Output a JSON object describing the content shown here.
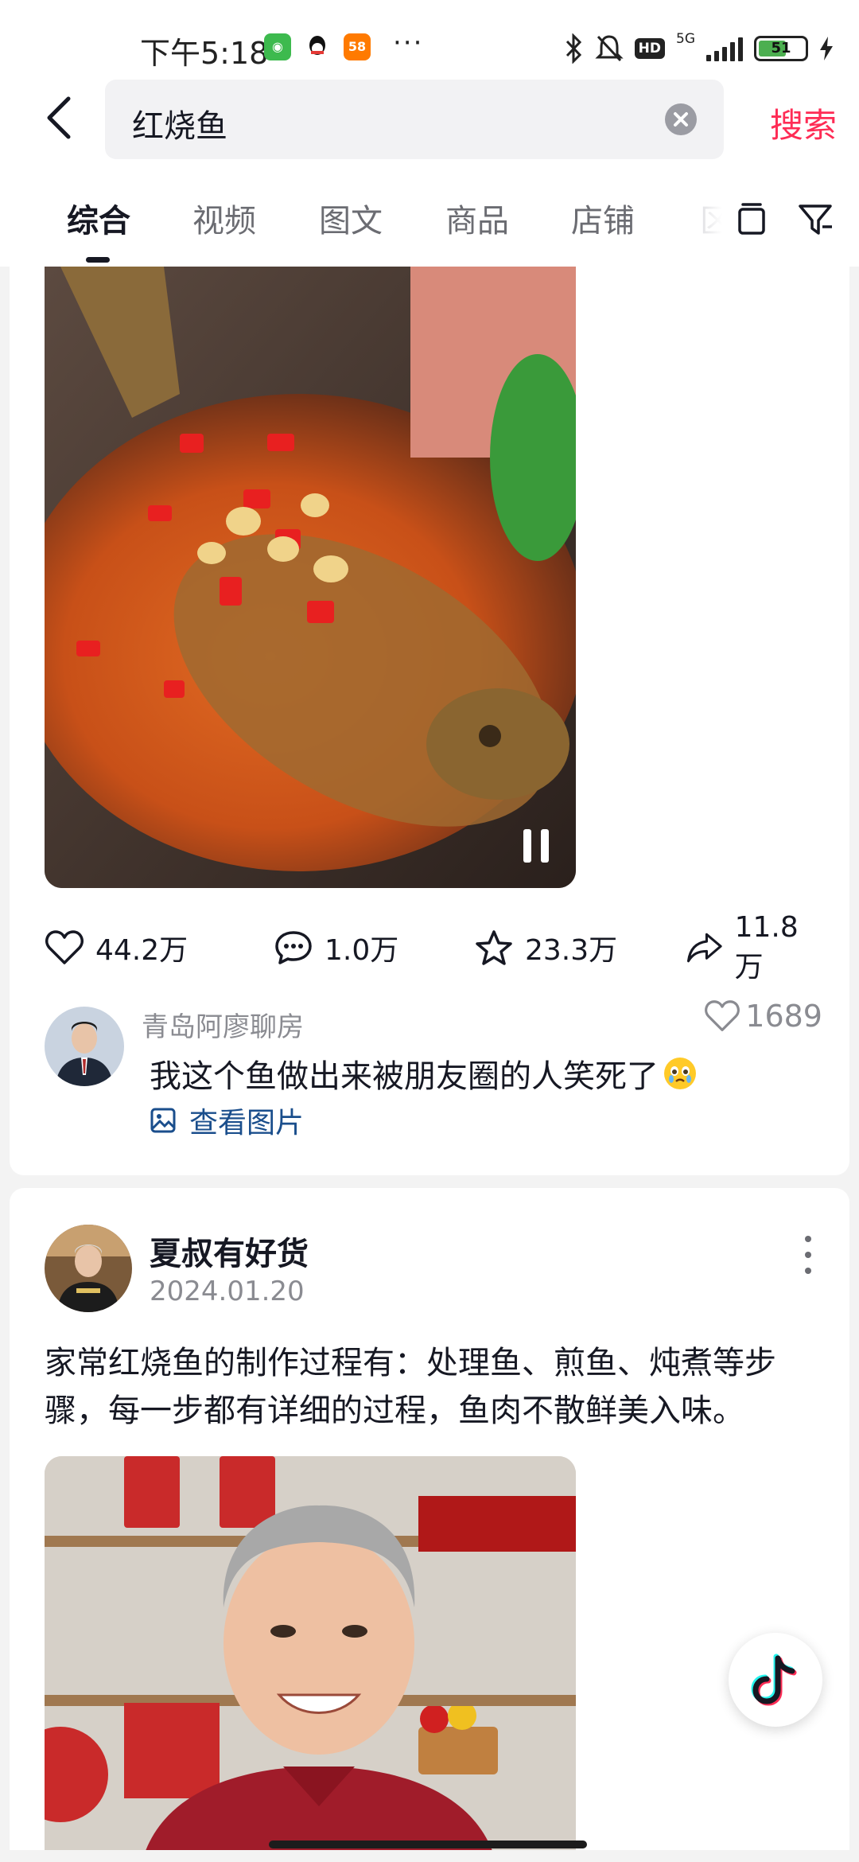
{
  "status_bar": {
    "time": "下午5:18",
    "app_icons": [
      "wechat-icon",
      "qq-icon",
      "58-app-icon"
    ],
    "more": "···",
    "hd_label": "HD",
    "network": "5G",
    "battery": "51"
  },
  "search": {
    "query": "红烧鱼",
    "submit_label": "搜索"
  },
  "tabs": [
    "综合",
    "视频",
    "图文",
    "商品",
    "店铺"
  ],
  "tab_overflow": "区",
  "active_tab": "综合",
  "video_post": {
    "likes": "44.2万",
    "comments": "1.0万",
    "favorites": "23.3万",
    "shares": "11.8万"
  },
  "top_comment": {
    "user": "青岛阿廖聊房",
    "likes": "1689",
    "text": "我这个鱼做出来被朋友圈的人笑死了",
    "emoji": "crying-face-emoji",
    "view_images": "查看图片"
  },
  "article_post": {
    "author": "夏叔有好货",
    "date": "2024.01.20",
    "text": "家常红烧鱼的制作过程有：处理鱼、煎鱼、炖煮等步骤，每一步都有详细的过程，鱼肉不散鲜美入味。"
  },
  "colors": {
    "accent": "#fe2c55",
    "link": "#1a4e8c",
    "text": "#161823",
    "muted": "#8a8b91"
  }
}
